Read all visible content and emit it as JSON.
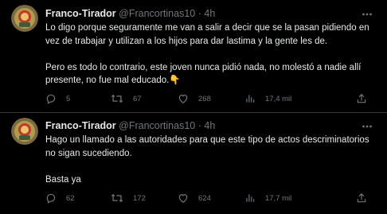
{
  "tweets": [
    {
      "display_name": "Franco-Tirador",
      "handle": "@Francortinas10",
      "separator": "·",
      "time": "4h",
      "text": "Lo digo porque seguramente me van a salir a decir que se la pasan pidiendo en vez de trabajar y utilizan a los hijos para dar lastima y la gente les de.\n\nPero es todo lo contrario, este joven nunca pidió nada, no molestó a nadie allí presente, no fue mal educado.👇",
      "replies": "5",
      "retweets": "67",
      "likes": "268",
      "views": "17,4 mil"
    },
    {
      "display_name": "Franco-Tirador",
      "handle": "@Francortinas10",
      "separator": "·",
      "time": "4h",
      "text": "Hago un llamado a las autoridades para que este tipo de actos descriminatorios no sigan sucediendo.\n\nBasta ya",
      "replies": "62",
      "retweets": "172",
      "likes": "624",
      "views": "17,7 mil"
    }
  ],
  "icons": {
    "reply": "reply-icon",
    "retweet": "retweet-icon",
    "like": "heart-icon",
    "views": "bar-chart-icon",
    "share": "share-icon",
    "more": "more-icon"
  },
  "colors": {
    "background": "#000000",
    "text": "#e7e9ea",
    "muted": "#71767b",
    "divider": "#2f3336"
  }
}
